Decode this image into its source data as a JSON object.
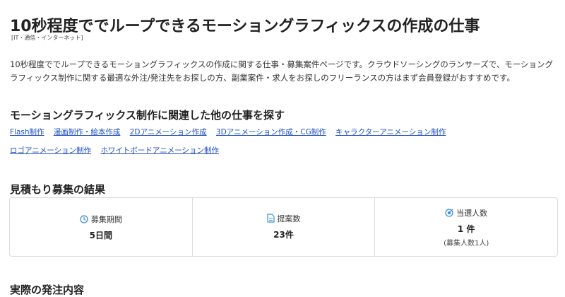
{
  "page": {
    "title": "10秒程度ででループできるモーショングラフィックスの作成の仕事",
    "category": "[IT・通信・インターネット]",
    "description": "10秒程度ででループできるモーショングラフィックスの作成に関する仕事・募集案件ページです。クラウドソーシングのランサーズで、モーショングラフィックス制作に関する最適な外注/発注先をお探しの方、副業案件・求人をお探しのフリーランスの方はまず会員登録がおすすめです。"
  },
  "related": {
    "heading": "モーショングラフィックス制作に関連した他の仕事を探す",
    "links": [
      "Flash制作",
      "漫画制作・絵本作成",
      "2Dアニメーション作成",
      "3Dアニメーション作成・CG制作",
      "キャラクターアニメーション制作",
      "ロゴアニメーション制作",
      "ホワイトボードアニメーション制作"
    ]
  },
  "results": {
    "heading": "見積もり募集の結果",
    "period": {
      "label": "募集期間",
      "value": "5日間",
      "icon": "clock-icon"
    },
    "proposals": {
      "label": "提案数",
      "value": "23件",
      "icon": "document-icon"
    },
    "selected": {
      "label": "当選人数",
      "value": "1 件",
      "sub": "(募集人数1人)",
      "icon": "target-icon"
    }
  },
  "actual": {
    "heading": "実際の発注内容"
  },
  "colors": {
    "link": "#1d4ec9",
    "icon_accent": "#3b8fdc",
    "border": "#dcdcdc"
  }
}
